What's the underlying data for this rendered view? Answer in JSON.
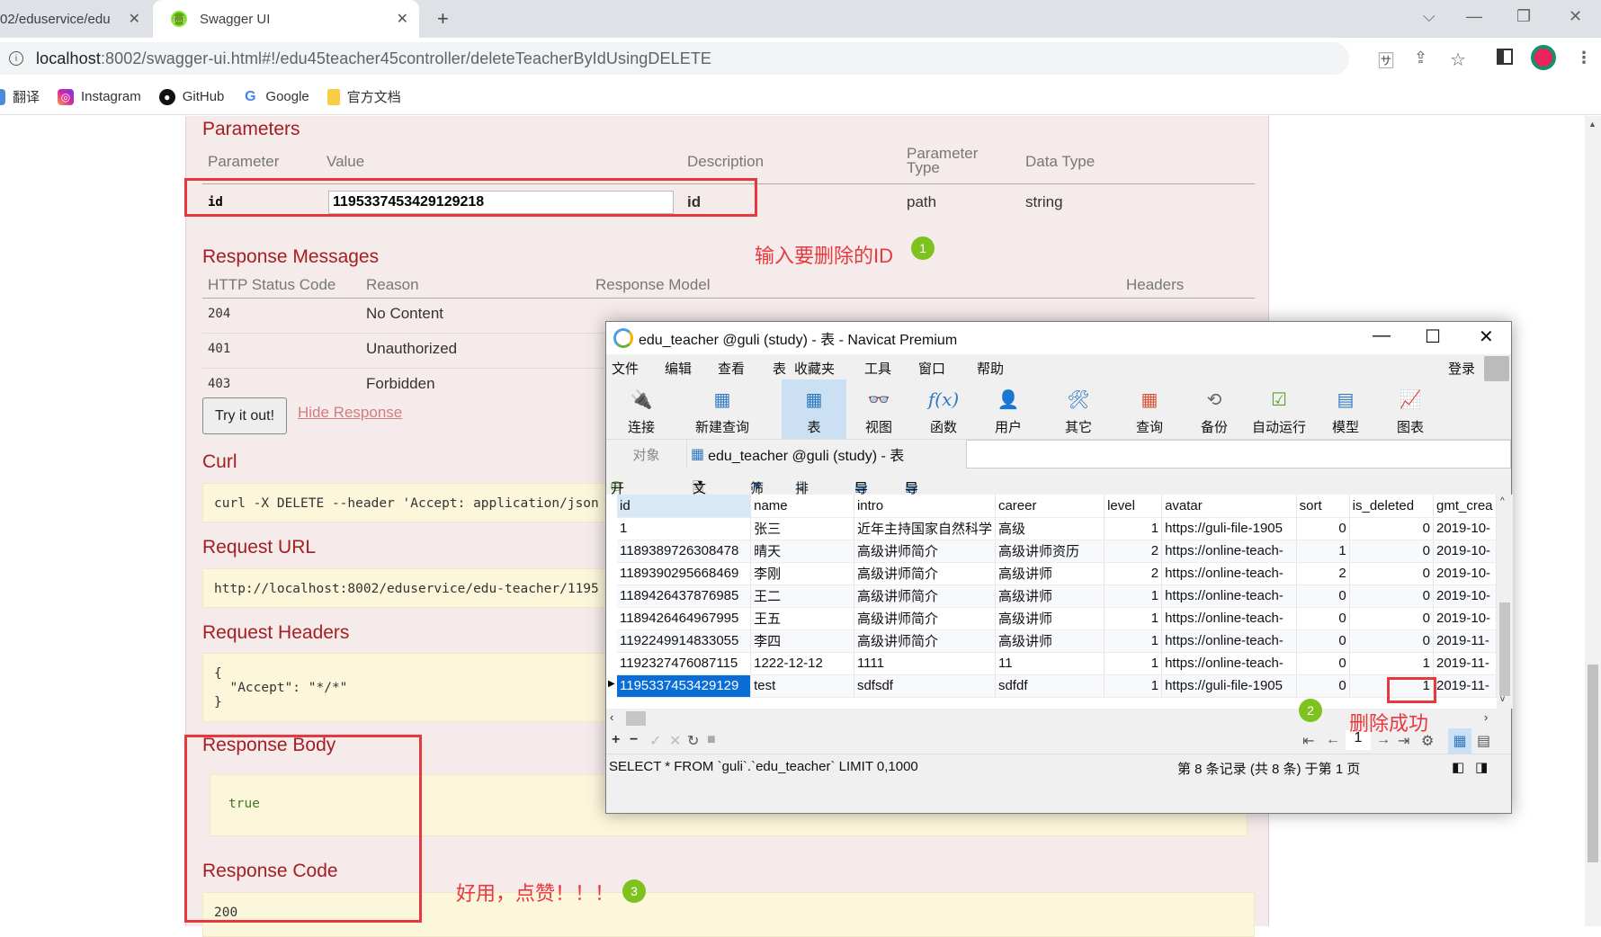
{
  "browser": {
    "tabs": [
      {
        "label": "02/eduservice/edu",
        "active": false
      },
      {
        "label": "Swagger UI",
        "active": true
      }
    ],
    "new_tab": "+",
    "url_host": "localhost",
    "url_rest": ":8002/swagger-ui.html#!/edu45teacher45controller/deleteTeacherByIdUsingDELETE",
    "bookmarks": [
      "翻译",
      "Instagram",
      "GitHub",
      "Google",
      "官方文档"
    ]
  },
  "swagger": {
    "parameters_title": "Parameters",
    "param_headers": {
      "parameter": "Parameter",
      "value": "Value",
      "description": "Description",
      "param_type": "Parameter Type",
      "data_type": "Data Type"
    },
    "param_row": {
      "name": "id",
      "value": "1195337453429129218",
      "description": "id",
      "param_type": "path",
      "data_type": "string"
    },
    "response_messages_title": "Response Messages",
    "resp_headers": {
      "code": "HTTP Status Code",
      "reason": "Reason",
      "model": "Response Model",
      "headers": "Headers"
    },
    "responses": [
      {
        "code": "204",
        "reason": "No Content"
      },
      {
        "code": "401",
        "reason": "Unauthorized"
      },
      {
        "code": "403",
        "reason": "Forbidden"
      }
    ],
    "try_button": "Try it out!",
    "hide_link": "Hide Response",
    "curl_title": "Curl",
    "curl": "curl -X DELETE --header 'Accept: application/json",
    "request_url_title": "Request URL",
    "request_url": "http://localhost:8002/eduservice/edu-teacher/1195",
    "request_headers_title": "Request Headers",
    "request_headers": "{\n  \"Accept\": \"*/*\"\n}",
    "response_body_title": "Response Body",
    "response_body": "true",
    "response_code_title": "Response Code",
    "response_code": "200"
  },
  "annotations": {
    "step1": "输入要删除的ID",
    "step2": "删除成功",
    "step3": "好用，点赞！！！",
    "badge1": "1",
    "badge2": "2",
    "badge3": "3"
  },
  "navicat": {
    "title": "edu_teacher @guli (study) - 表 - Navicat Premium",
    "menu": [
      "文件",
      "编辑",
      "查看",
      "表",
      "收藏夹",
      "工具",
      "窗口",
      "帮助"
    ],
    "login": "登录",
    "tools": [
      "连接",
      "新建查询",
      "表",
      "视图",
      "函数",
      "用户",
      "其它",
      "查询",
      "备份",
      "自动运行",
      "模型",
      "图表"
    ],
    "tab_objects": "对象",
    "tab_table": "edu_teacher @guli (study) - 表",
    "subtoolbar": [
      "开始事务",
      "文本",
      "筛选",
      "排序",
      "导入",
      "导出"
    ],
    "columns": [
      "id",
      "name",
      "intro",
      "career",
      "level",
      "avatar",
      "sort",
      "is_deleted",
      "gmt_crea"
    ],
    "rows": [
      [
        "1",
        "张三",
        "近年主持国家自然科学",
        "高级",
        "1",
        "https://guli-file-1905",
        "0",
        "0",
        "2019-10-"
      ],
      [
        "1189389726308478",
        "晴天",
        "高级讲师简介",
        "高级讲师资历",
        "2",
        "https://online-teach-",
        "1",
        "0",
        "2019-10-"
      ],
      [
        "1189390295668469",
        "李刚",
        "高级讲师简介",
        "高级讲师",
        "2",
        "https://online-teach-",
        "2",
        "0",
        "2019-10-"
      ],
      [
        "1189426437876985",
        "王二",
        "高级讲师简介",
        "高级讲师",
        "1",
        "https://online-teach-",
        "0",
        "0",
        "2019-10-"
      ],
      [
        "1189426464967995",
        "王五",
        "高级讲师简介",
        "高级讲师",
        "1",
        "https://online-teach-",
        "0",
        "0",
        "2019-10-"
      ],
      [
        "1192249914833055",
        "李四",
        "高级讲师简介",
        "高级讲师",
        "1",
        "https://online-teach-",
        "0",
        "0",
        "2019-11-"
      ],
      [
        "1192327476087115",
        "1222-12-12",
        "1111",
        "11",
        "1",
        "https://online-teach-",
        "0",
        "1",
        "2019-11-"
      ],
      [
        "1195337453429129",
        "test",
        "sdfsdf",
        "sdfdf",
        "1",
        "https://guli-file-1905",
        "0",
        "1",
        "2019-11-"
      ]
    ],
    "page_number": "1",
    "sql": "SELECT * FROM `guli`.`edu_teacher` LIMIT 0,1000",
    "record_status": "第 8 条记录 (共 8 条) 于第 1 页"
  }
}
